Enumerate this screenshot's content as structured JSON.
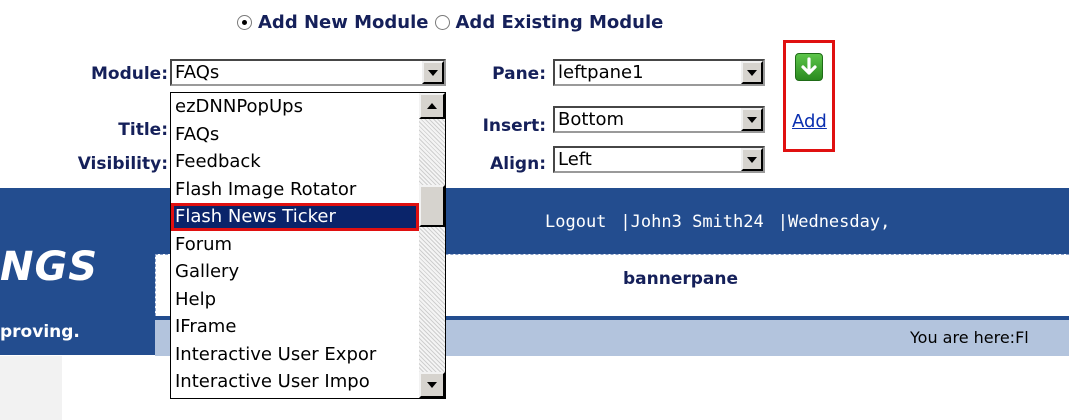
{
  "mode": {
    "options": [
      {
        "label": "Add New Module",
        "checked": true
      },
      {
        "label": "Add Existing Module",
        "checked": false
      }
    ]
  },
  "labels": {
    "module": "Module:",
    "title": "Title:",
    "visibility": "Visibility:",
    "pane": "Pane:",
    "insert": "Insert:",
    "align": "Align:"
  },
  "fields": {
    "module": "FAQs",
    "pane": "leftpane1",
    "insert": "Bottom",
    "align": "Left"
  },
  "add": {
    "link": "Add",
    "icon": "green-down-arrow-icon"
  },
  "module_list": {
    "items": [
      "ezDNNPopUps",
      "FAQs",
      "Feedback",
      "Flash Image Rotator",
      "Flash News Ticker",
      "Forum",
      "Gallery",
      "Help",
      "IFrame",
      "Interactive User Expor",
      "Interactive User Impo"
    ],
    "selected": "Flash News Ticker"
  },
  "page": {
    "logo": "NGS",
    "slogan": "proving.",
    "nav": {
      "logout": "Logout",
      "separator": "|",
      "user": "John3 Smith24",
      "date": "Wednesday,"
    },
    "banner": "bannerpane",
    "breadcrumb": "You are here:Fl"
  },
  "colors": {
    "header_blue": "#234d8f",
    "crumb_bar": "#b3c4dd",
    "label_navy": "#15205a",
    "selection": "#0a246a",
    "highlight_red": "#e01010",
    "add_green": "#3aa82c"
  }
}
